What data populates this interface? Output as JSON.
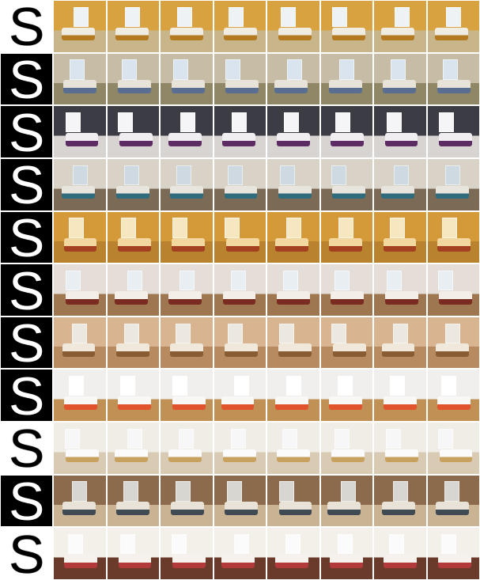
{
  "rows": [
    {
      "mask_glyph": "S",
      "mask_style": "white",
      "palette": {
        "wall": "#d7a23f",
        "floor": "#c9b58a",
        "bed": "#f1ece1",
        "accent": "#b47a22",
        "window": "#eef2f4"
      }
    },
    {
      "mask_glyph": "S",
      "mask_style": "black",
      "palette": {
        "wall": "#c7bca5",
        "floor": "#8f8766",
        "bed": "#e7e3d9",
        "accent": "#5a6e91",
        "window": "#d9e4ee"
      }
    },
    {
      "mask_glyph": "S",
      "mask_style": "black",
      "palette": {
        "wall": "#3b3c44",
        "floor": "#d8d4d2",
        "bed": "#f0eef1",
        "accent": "#5e2c64",
        "window": "#f5f5f7"
      }
    },
    {
      "mask_glyph": "S",
      "mask_style": "black",
      "palette": {
        "wall": "#d9d2c6",
        "floor": "#7b6a55",
        "bed": "#e8e4de",
        "accent": "#2f6d7e",
        "window": "#cfd9e1"
      }
    },
    {
      "mask_glyph": "S",
      "mask_style": "black",
      "palette": {
        "wall": "#d49a3a",
        "floor": "#b8822e",
        "bed": "#f2d8a0",
        "accent": "#a3401f",
        "window": "#f6e7c0"
      }
    },
    {
      "mask_glyph": "S",
      "mask_style": "black",
      "palette": {
        "wall": "#e5ded8",
        "floor": "#9e7750",
        "bed": "#f3eee8",
        "accent": "#7a2b22",
        "window": "#e9eef3"
      }
    },
    {
      "mask_glyph": "S",
      "mask_style": "black",
      "palette": {
        "wall": "#d8b590",
        "floor": "#b88a5f",
        "bed": "#f1e8dc",
        "accent": "#8a5c33",
        "window": "#ece7df"
      }
    },
    {
      "mask_glyph": "S",
      "mask_style": "black",
      "palette": {
        "wall": "#f1efee",
        "floor": "#c09055",
        "bed": "#faf8f6",
        "accent": "#e0532c",
        "window": "#ffffff"
      }
    },
    {
      "mask_glyph": "S",
      "mask_style": "white",
      "palette": {
        "wall": "#f0ece6",
        "floor": "#d9cbb3",
        "bed": "#fbfbfb",
        "accent": "#c9a15f",
        "window": "#f7f7f7"
      }
    },
    {
      "mask_glyph": "S",
      "mask_style": "black",
      "palette": {
        "wall": "#8b6b4b",
        "floor": "#c9b392",
        "bed": "#e9e2d7",
        "accent": "#3f4a52",
        "window": "#d8d6d1"
      }
    },
    {
      "mask_glyph": "S",
      "mask_style": "white",
      "palette": {
        "wall": "#f3efe9",
        "floor": "#6a3b2a",
        "bed": "#f6f1ec",
        "accent": "#b23a3a",
        "window": "#fbfbfb"
      }
    }
  ],
  "columns_per_row": 9
}
